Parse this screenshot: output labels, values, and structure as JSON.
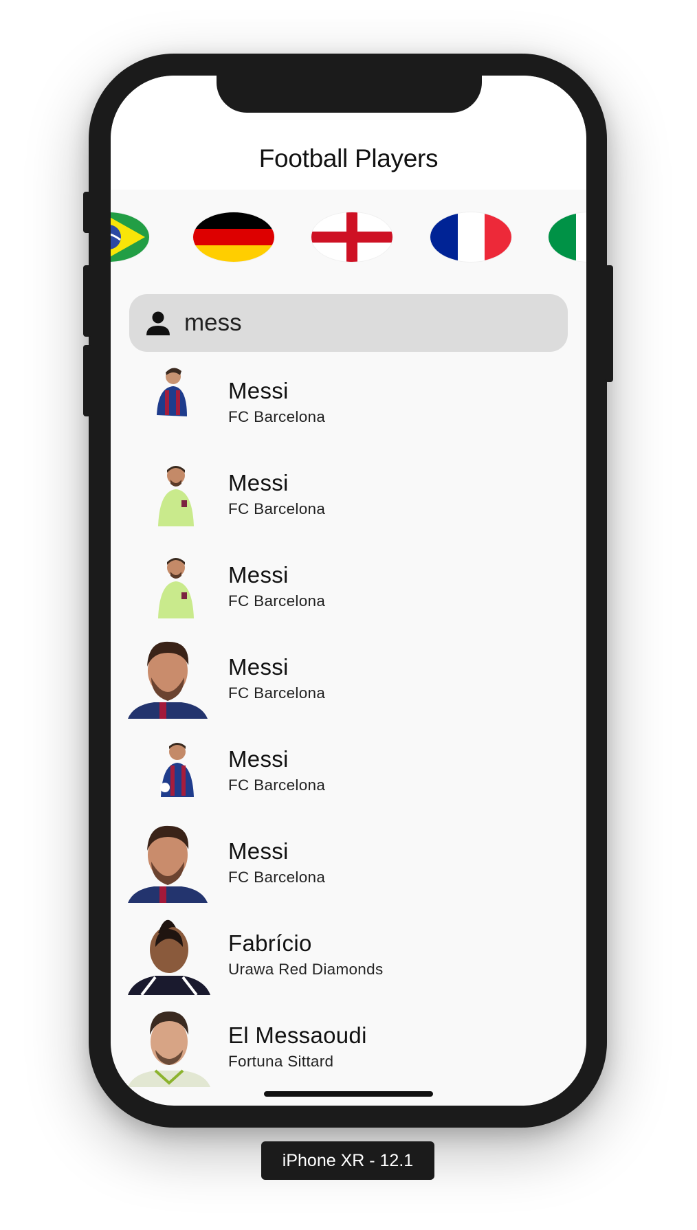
{
  "app": {
    "title": "Football Players"
  },
  "flags": [
    {
      "country": "Brazil",
      "icon": "brazil-flag-icon"
    },
    {
      "country": "Germany",
      "icon": "germany-flag-icon"
    },
    {
      "country": "England",
      "icon": "england-flag-icon"
    },
    {
      "country": "France",
      "icon": "france-flag-icon"
    },
    {
      "country": "Italy",
      "icon": "italy-flag-icon"
    }
  ],
  "search": {
    "value": "mess",
    "icon": "person-icon"
  },
  "players": [
    {
      "name": "Messi",
      "club": "FC Barcelona"
    },
    {
      "name": "Messi",
      "club": "FC Barcelona"
    },
    {
      "name": "Messi",
      "club": "FC Barcelona"
    },
    {
      "name": "Messi",
      "club": "FC Barcelona"
    },
    {
      "name": "Messi",
      "club": "FC Barcelona"
    },
    {
      "name": "Messi",
      "club": "FC Barcelona"
    },
    {
      "name": "Fabrício",
      "club": "Urawa Red Diamonds"
    },
    {
      "name": "El Messaoudi",
      "club": "Fortuna Sittard"
    }
  ],
  "simulator": {
    "label": "iPhone XR - 12.1"
  },
  "colors": {
    "screen_background": "#f9f9f9",
    "search_background": "#dcdcdc",
    "device_frame": "#1b1b1b"
  }
}
